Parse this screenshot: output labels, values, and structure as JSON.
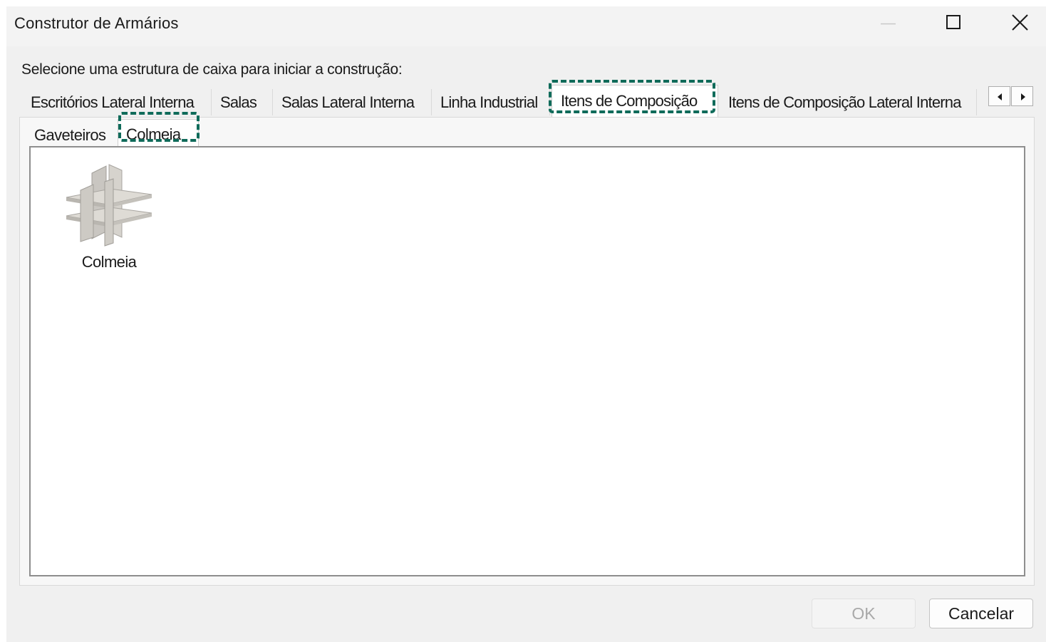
{
  "window": {
    "title": "Construtor de Armários",
    "controls": [
      "minimize-icon",
      "maximize-icon",
      "close-icon"
    ]
  },
  "instruction": "Selecione uma estrutura de caixa para iniciar a construção:",
  "tabs": [
    {
      "label": "Escritórios Lateral Interna",
      "active": false
    },
    {
      "label": "Salas",
      "active": false
    },
    {
      "label": "Salas Lateral Interna",
      "active": false
    },
    {
      "label": "Linha Industrial",
      "active": false
    },
    {
      "label": "Itens de Composição",
      "active": true
    },
    {
      "label": "Itens de Composição Lateral Interna",
      "active": false
    }
  ],
  "tab_scroll": {
    "left_icon": "scroll-left-icon",
    "right_icon": "scroll-right-icon"
  },
  "subtabs": [
    {
      "label": "Gaveteiros",
      "active": false
    },
    {
      "label": "Colmeia",
      "active": true
    }
  ],
  "items": [
    {
      "label": "Colmeia",
      "icon": "honeycomb-shelf-icon"
    }
  ],
  "buttons": {
    "ok": "OK",
    "cancel": "Cancelar",
    "ok_enabled": false
  },
  "colors": {
    "highlight": "#0f6b5a",
    "content_border": "#8e8e8e"
  }
}
